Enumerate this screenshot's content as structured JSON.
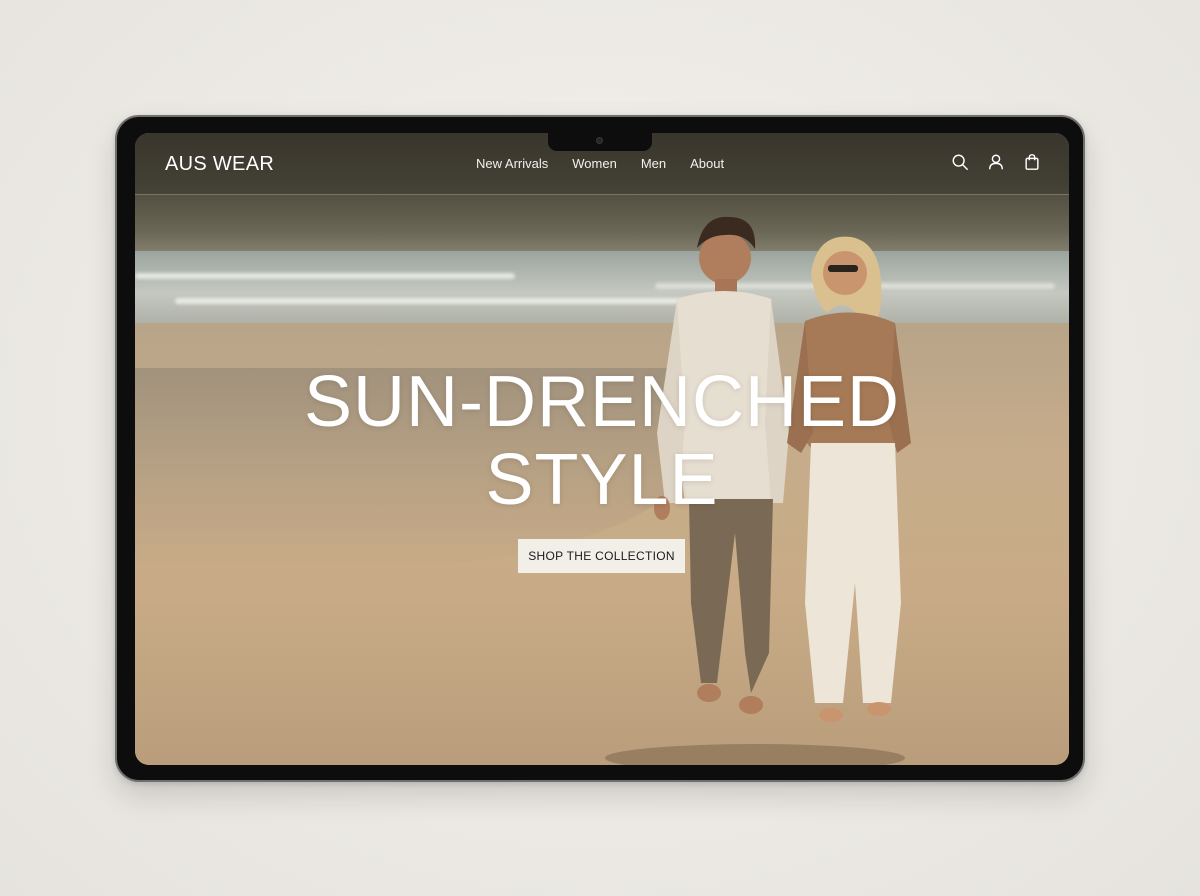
{
  "brand": {
    "logo_text": "AUS WEAR"
  },
  "nav": {
    "items": [
      {
        "label": "New Arrivals"
      },
      {
        "label": "Women"
      },
      {
        "label": "Men"
      },
      {
        "label": "About"
      }
    ],
    "icons": [
      "search-icon",
      "account-icon",
      "shopping-bag-icon"
    ]
  },
  "hero": {
    "title_line1": "SUN-DRENCHED",
    "title_line2": "STYLE",
    "cta_label": "SHOP THE COLLECTION",
    "image_description_icon": "hero-image"
  },
  "colors": {
    "page_bg": "#ece9e4",
    "device_frame": "#0d0d0d",
    "cta_bg": "#f2eee8",
    "text_light": "#ffffff",
    "sand": "#c6ac8a"
  }
}
